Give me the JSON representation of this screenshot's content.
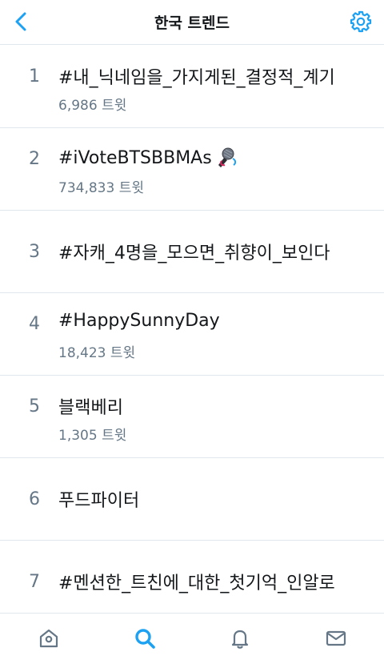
{
  "header": {
    "title": "한국 트렌드",
    "back_icon": "chevron-left-icon",
    "settings_icon": "gear-icon",
    "accent_color": "#1da1f2"
  },
  "trends": [
    {
      "rank": "1",
      "name": "#내_닉네임을_가지게된_결정적_계기",
      "count": "6,986 트윗"
    },
    {
      "rank": "2",
      "name": "#iVoteBTSBBMAs",
      "count": "734,833 트윗",
      "emoji_icon": "microphone-icon"
    },
    {
      "rank": "3",
      "name": "#자캐_4명을_모으면_취향이_보인다",
      "count": ""
    },
    {
      "rank": "4",
      "name": "#HappySunnyDay",
      "count": "18,423 트윗"
    },
    {
      "rank": "5",
      "name": "블랙베리",
      "count": "1,305 트윗"
    },
    {
      "rank": "6",
      "name": "푸드파이터",
      "count": ""
    },
    {
      "rank": "7",
      "name": "#멘션한_트친에_대한_첫기억_인알로",
      "count": ""
    }
  ],
  "tabbar": {
    "tabs": [
      {
        "icon": "home-icon",
        "active": false
      },
      {
        "icon": "search-icon",
        "active": true
      },
      {
        "icon": "bell-icon",
        "active": false
      },
      {
        "icon": "mail-icon",
        "active": false
      }
    ]
  }
}
